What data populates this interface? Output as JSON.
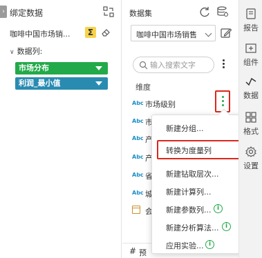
{
  "left_panel": {
    "title": "绑定数据",
    "bound_dataset": "咖啡中国市场销...",
    "sum_symbol": "Σ",
    "columns_label": "数据列:",
    "pills": [
      {
        "label": "市场分布",
        "color": "#22a94a"
      },
      {
        "label": "利润_最小值",
        "color": "#2a8bb1"
      }
    ]
  },
  "dataset_panel": {
    "title": "数据集",
    "selected_dataset": "咖啡中国市场销售",
    "search": {
      "placeholder": "输入搜索文字",
      "value": ""
    },
    "dimension_label": "维度",
    "fields": [
      {
        "type": "Abc",
        "name": "市场级别"
      },
      {
        "type": "Abc",
        "name": "市"
      },
      {
        "type": "Abc",
        "name": "产"
      },
      {
        "type": "Abc",
        "name": "产"
      },
      {
        "type": "Abc",
        "name": "省"
      },
      {
        "type": "Abc",
        "name": "城"
      },
      {
        "type": "date",
        "name": "会"
      }
    ],
    "bottom_strip": {
      "symbol": "#",
      "label": "预"
    }
  },
  "context_menu": {
    "items": [
      {
        "label": "新建分组...",
        "info": false
      },
      {
        "label": "转换为度量列",
        "info": false
      },
      {
        "label": "新建钻取层次...",
        "info": false
      },
      {
        "label": "新建计算列...",
        "info": false
      },
      {
        "label": "新建参数列...",
        "info": true
      },
      {
        "label": "新建分析算法...",
        "info": true
      },
      {
        "label": "应用实验...",
        "info": true
      }
    ],
    "info_symbol": "i"
  },
  "right_rail": {
    "items": [
      {
        "label": "报告",
        "icon": "report-icon"
      },
      {
        "label": "组件",
        "icon": "component-icon"
      },
      {
        "label": "数据",
        "icon": "data-icon"
      },
      {
        "label": "格式",
        "icon": "format-icon"
      },
      {
        "label": "设置",
        "icon": "settings-icon"
      }
    ]
  },
  "colors": {
    "accent_green": "#22a94a",
    "accent_teal": "#2a8bb1",
    "highlight_red": "#d9261c",
    "abc_blue": "#1f8ec6"
  }
}
